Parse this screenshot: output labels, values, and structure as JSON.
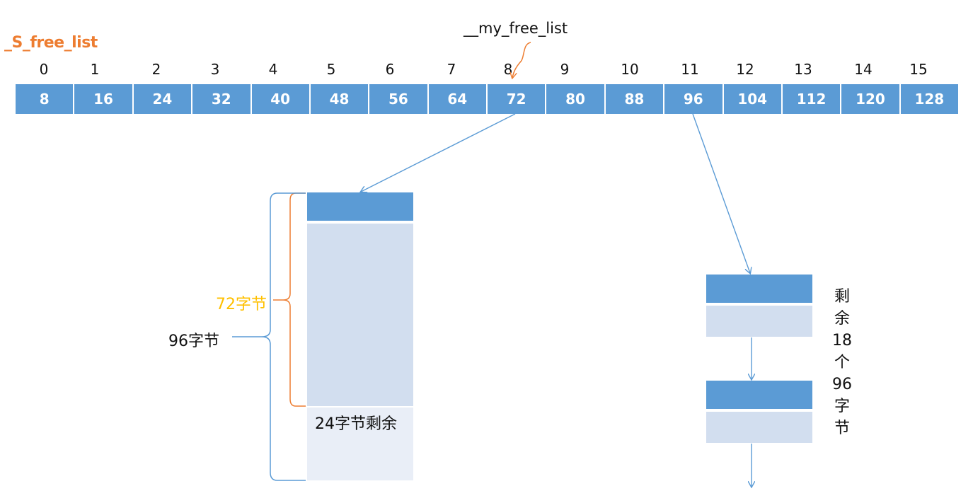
{
  "free_list_label": "_S_free_list",
  "pointer_label": "__my_free_list",
  "indices": [
    "0",
    "1",
    "2",
    "3",
    "4",
    "5",
    "6",
    "7",
    "8",
    "9",
    "10",
    "11",
    "12",
    "13",
    "14",
    "15"
  ],
  "sizes": [
    "8",
    "16",
    "24",
    "32",
    "40",
    "48",
    "56",
    "64",
    "72",
    "80",
    "88",
    "96",
    "104",
    "112",
    "120",
    "128"
  ],
  "labels": {
    "allocated": "72字节",
    "block_total": "96字节",
    "remaining": "24字节剩余",
    "remaining_chunks": "剩余18个96字节"
  },
  "colors": {
    "accent_orange": "#ed7d31",
    "label_gold": "#ffc000",
    "cell_blue": "#5b9bd5",
    "block_light": "#d2deef",
    "block_pale": "#e9eef7"
  }
}
